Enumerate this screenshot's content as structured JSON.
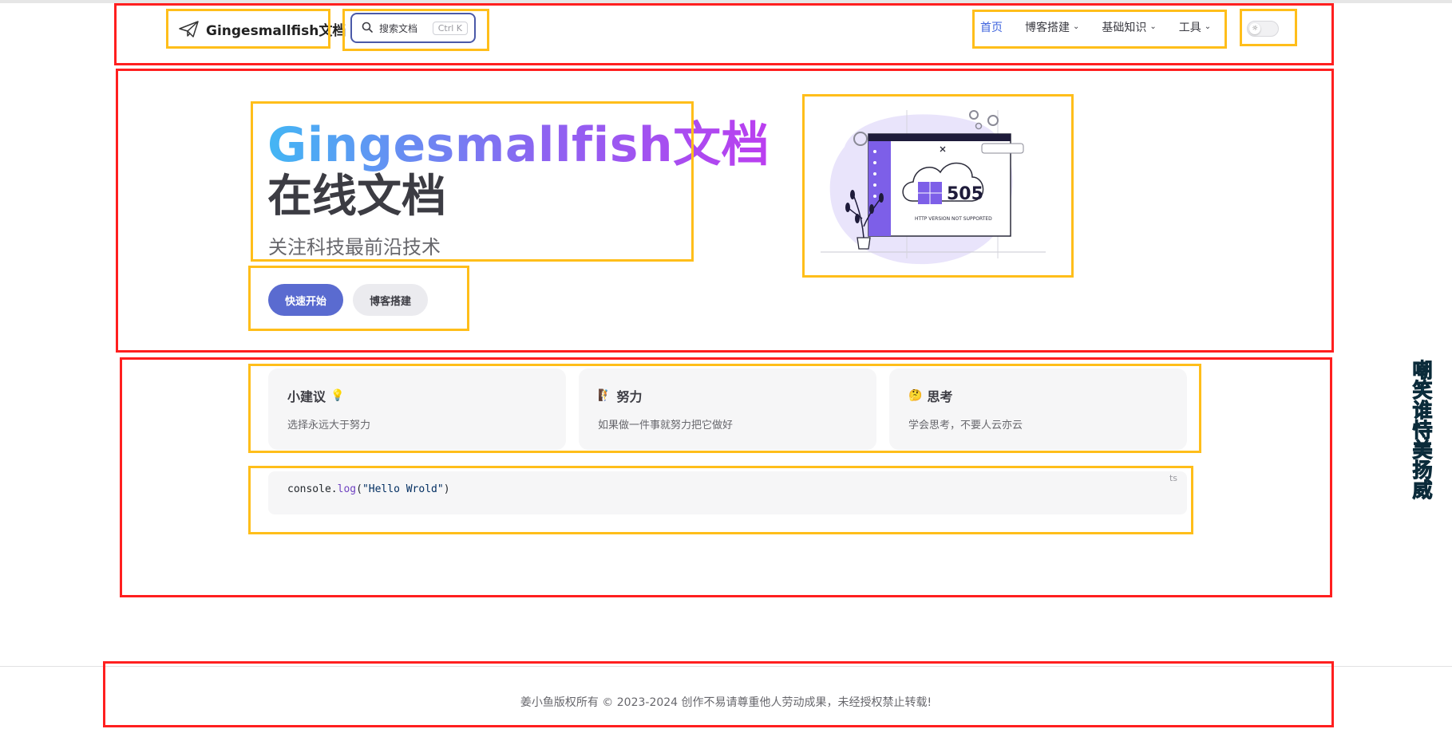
{
  "header": {
    "site_title": "Gingesmallfish文档",
    "search": {
      "label": "搜索文档",
      "kbd": "Ctrl K"
    },
    "nav": [
      {
        "label": "首页",
        "active": true
      },
      {
        "label": "博客搭建",
        "dropdown": true
      },
      {
        "label": "基础知识",
        "dropdown": true
      },
      {
        "label": "工具",
        "dropdown": true
      }
    ]
  },
  "hero": {
    "name": "Gingesmallfish文档",
    "text": "在线文档",
    "tagline": "关注科技最前沿技术",
    "actions": [
      {
        "label": "快速开始",
        "theme": "brand"
      },
      {
        "label": "博客搭建",
        "theme": "alt"
      }
    ],
    "image": {
      "code": "505",
      "caption": "HTTP VERSION NOT SUPPORTED"
    }
  },
  "features": [
    {
      "title": "小建议",
      "emoji": "💡",
      "emoji_position": "after",
      "details": "选择永远大于努力"
    },
    {
      "title": "努力",
      "emoji": "🧗",
      "emoji_position": "before",
      "details": "如果做一件事就努力把它做好"
    },
    {
      "title": "思考",
      "emoji": "🤔",
      "emoji_position": "before",
      "details": "学会思考，不要人云亦云"
    }
  ],
  "code": {
    "lang": "ts",
    "object": "console",
    "method": "log",
    "argument": "\"Hello Wrold\""
  },
  "footer": {
    "text": "姜小鱼版权所有 © 2023-2024 创作不易请尊重他人劳动成果，未经授权禁止转载!"
  },
  "side_text": "嘲笑谁恃美扬威",
  "colors": {
    "brand": "#5a6bd0",
    "nav_active": "#3e63dd",
    "annotation_red": "#ff1f1f",
    "annotation_yellow": "#ffbe1a",
    "side_text": "#0fb1d8"
  }
}
